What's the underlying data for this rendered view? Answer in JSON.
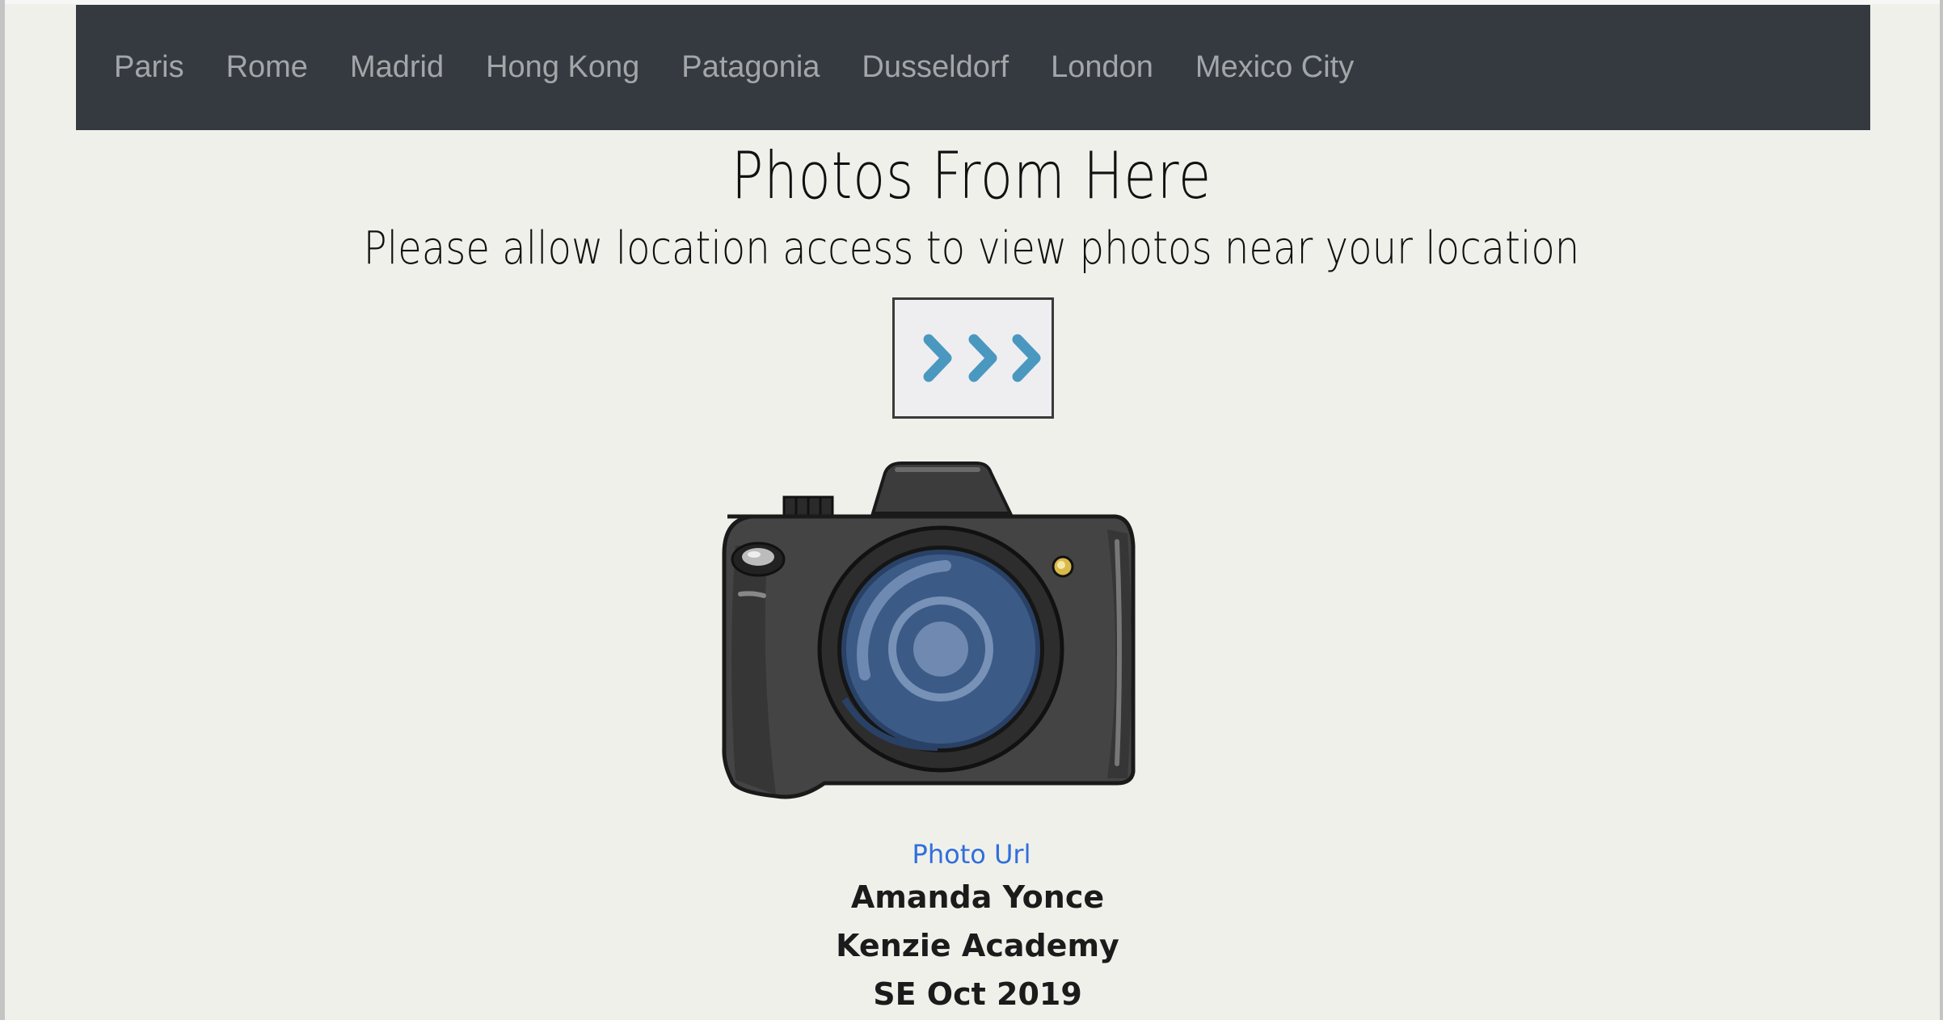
{
  "nav": {
    "items": [
      {
        "label": "Paris"
      },
      {
        "label": "Rome"
      },
      {
        "label": "Madrid"
      },
      {
        "label": "Hong Kong"
      },
      {
        "label": "Patagonia"
      },
      {
        "label": "Dusseldorf"
      },
      {
        "label": "London"
      },
      {
        "label": "Mexico City"
      }
    ]
  },
  "main": {
    "title": "Photos From Here",
    "subtitle": "Please allow location access to view photos near your location",
    "next_button_icon": "triple-chevron-right-icon",
    "image_icon": "camera-icon",
    "photo_link": "Photo Url"
  },
  "footer": {
    "author": "Amanda Yonce",
    "school": "Kenzie Academy",
    "cohort": "SE Oct 2019"
  },
  "colors": {
    "navbar": "#343a40",
    "background": "#f0f0eb",
    "link": "#2f6fdb",
    "chevron": "#4a98c0"
  }
}
